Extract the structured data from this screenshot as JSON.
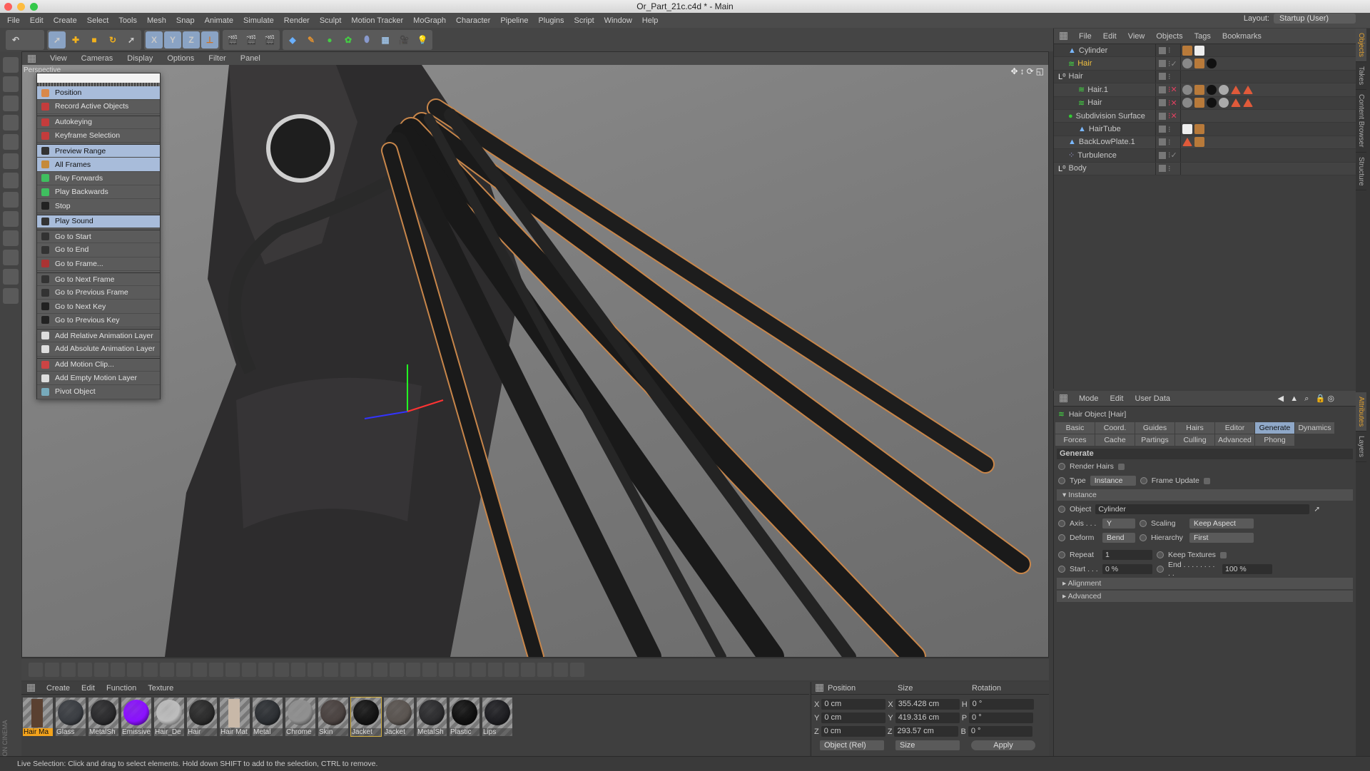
{
  "window": {
    "title": "Or_Part_21c.c4d * - Main"
  },
  "menubar": [
    "File",
    "Edit",
    "Create",
    "Select",
    "Tools",
    "Mesh",
    "Snap",
    "Animate",
    "Simulate",
    "Render",
    "Sculpt",
    "Motion Tracker",
    "MoGraph",
    "Character",
    "Pipeline",
    "Plugins",
    "Script",
    "Window",
    "Help"
  ],
  "layout": {
    "label": "Layout:",
    "value": "Startup (User)"
  },
  "toolbar": {
    "axis_x": "X",
    "axis_y": "Y",
    "axis_z": "Z"
  },
  "viewport": {
    "menu": [
      "View",
      "Cameras",
      "Display",
      "Options",
      "Filter",
      "Panel"
    ],
    "label": "Perspective"
  },
  "anim_menu": {
    "items": [
      {
        "label": "Position",
        "hl": true,
        "icon": "position-icon",
        "c": "#d9884a"
      },
      {
        "label": "Record Active Objects",
        "icon": "record-icon",
        "c": "#c43c3c"
      },
      {
        "label": "Autokeying",
        "sep": true,
        "icon": "autokey-icon",
        "c": "#c43c3c"
      },
      {
        "label": "Keyframe Selection",
        "icon": "keyframe-selection-icon",
        "c": "#c43c3c"
      },
      {
        "label": "Preview Range",
        "hl": true,
        "sep": true,
        "icon": "preview-range-icon",
        "c": "#333"
      },
      {
        "label": "All Frames",
        "hl": true,
        "icon": "film-icon",
        "c": "#c58a3a"
      },
      {
        "label": "Play Forwards",
        "icon": "play-forwards-icon",
        "c": "#3fbf5f"
      },
      {
        "label": "Play Backwards",
        "icon": "play-backwards-icon",
        "c": "#3fbf5f"
      },
      {
        "label": "Stop",
        "icon": "stop-icon",
        "c": "#222"
      },
      {
        "label": "Play Sound",
        "hl": true,
        "sep": true,
        "icon": "speaker-icon",
        "c": "#333"
      },
      {
        "label": "Go to Start",
        "sep": true,
        "icon": "go-to-start-icon",
        "c": "#333"
      },
      {
        "label": "Go to End",
        "icon": "go-to-end-icon",
        "c": "#333"
      },
      {
        "label": "Go to Frame...",
        "icon": "go-to-frame-icon",
        "c": "#a33"
      },
      {
        "label": "Go to Next Frame",
        "sep": true,
        "icon": "next-frame-icon",
        "c": "#333"
      },
      {
        "label": "Go to Previous Frame",
        "icon": "previous-frame-icon",
        "c": "#333"
      },
      {
        "label": "Go to Next Key",
        "icon": "next-key-icon",
        "c": "#222"
      },
      {
        "label": "Go to Previous Key",
        "icon": "previous-key-icon",
        "c": "#222"
      },
      {
        "label": "Add Relative Animation Layer",
        "sep": true,
        "icon": "relative-layer-icon",
        "c": "#ddd"
      },
      {
        "label": "Add Absolute Animation Layer",
        "icon": "absolute-layer-icon",
        "c": "#ddd"
      },
      {
        "label": "Add Motion Clip...",
        "sep": true,
        "icon": "motion-clip-icon",
        "c": "#c44"
      },
      {
        "label": "Add Empty Motion Layer",
        "icon": "motion-layer-icon",
        "c": "#ddd"
      },
      {
        "label": "Pivot Object",
        "icon": "pivot-icon",
        "c": "#7ab"
      }
    ]
  },
  "objects": {
    "menu": [
      "File",
      "Edit",
      "View",
      "Objects",
      "Tags",
      "Bookmarks"
    ],
    "rows": [
      {
        "name": "Cylinder",
        "indent": 1,
        "icon": "cylinder-icon",
        "tags": [
          "phong",
          "checker"
        ]
      },
      {
        "name": "Hair",
        "indent": 1,
        "icon": "hair-icon",
        "selected": true,
        "check": true,
        "tags": [
          "hair-material",
          "phong",
          "black-material"
        ]
      },
      {
        "name": "Hair",
        "indent": 0,
        "icon": "null-icon",
        "tags": []
      },
      {
        "name": "Hair.1",
        "indent": 2,
        "icon": "hair-icon",
        "x": true,
        "tags": [
          "hair-material",
          "phong",
          "black-material",
          "gray-material",
          "triangle",
          "triangle"
        ]
      },
      {
        "name": "Hair",
        "indent": 2,
        "icon": "hair-icon",
        "x": true,
        "tags": [
          "hair-material",
          "phong",
          "black-material",
          "gray-material",
          "triangle",
          "triangle"
        ]
      },
      {
        "name": "Subdivision Surface",
        "indent": 1,
        "icon": "subdivision-icon",
        "x": true,
        "tags": []
      },
      {
        "name": "HairTube",
        "indent": 2,
        "icon": "cylinder-icon",
        "tags": [
          "checker",
          "phong"
        ]
      },
      {
        "name": "BackLowPlate.1",
        "indent": 1,
        "icon": "cylinder-icon",
        "tags": [
          "triangle",
          "phong"
        ]
      },
      {
        "name": "Turbulence",
        "indent": 1,
        "icon": "turbulence-icon",
        "check": true,
        "tags": []
      },
      {
        "name": "Body",
        "indent": 0,
        "icon": "null-icon",
        "tags": []
      }
    ]
  },
  "right_tabs": [
    "Objects",
    "Takes",
    "Content Browser",
    "Structure"
  ],
  "right_tabs_lower": [
    "Attributes",
    "Layers"
  ],
  "attributes": {
    "menu": [
      "Mode",
      "Edit",
      "User Data"
    ],
    "object_title": "Hair Object [Hair]",
    "tabs": [
      "Basic",
      "Coord.",
      "Guides",
      "Hairs",
      "Editor",
      "Generate",
      "Dynamics",
      "Forces",
      "Cache",
      "Partings",
      "Culling",
      "Advanced",
      "Phong"
    ],
    "active_tab": "Generate",
    "section": "Generate",
    "render_hairs": "Render Hairs",
    "type_label": "Type",
    "type_value": "Instance",
    "frame_update": "Frame Update",
    "instance_section": "Instance",
    "object_label": "Object",
    "object_value": "Cylinder",
    "axis_label": "Axis . . .",
    "axis_value": "Y",
    "scaling_label": "Scaling",
    "scaling_value": "Keep Aspect",
    "deform_label": "Deform",
    "deform_value": "Bend",
    "hierarchy_label": "Hierarchy",
    "hierarchy_value": "First",
    "repeat_label": "Repeat",
    "repeat_value": "1",
    "keep_textures": "Keep Textures",
    "start_label": "Start . . .",
    "start_value": "0 %",
    "end_label": "End . . . . . . . . . .",
    "end_value": "100 %",
    "alignment": "Alignment",
    "advanced": "Advanced"
  },
  "materials": {
    "menu": [
      "Create",
      "Edit",
      "Function",
      "Texture"
    ],
    "items": [
      {
        "name": "Hair Ma",
        "color": "#5a4030",
        "sel": true,
        "flat": true
      },
      {
        "name": "Glass",
        "color": "#3a3d42"
      },
      {
        "name": "MetalSh",
        "color": "#2a2a2c"
      },
      {
        "name": "Emissive",
        "color": "#8a10ff"
      },
      {
        "name": "Hair_De",
        "color": "#bdbdbd"
      },
      {
        "name": "Hair",
        "color": "#2a2a2a"
      },
      {
        "name": "Hair Mat",
        "color": "#c8b8a8",
        "flat": true
      },
      {
        "name": "Metal",
        "color": "#2c2f33"
      },
      {
        "name": "Chrome",
        "color": "#909090"
      },
      {
        "name": "Skin",
        "color": "#4a4240"
      },
      {
        "name": "Jacket",
        "color": "#141414",
        "sel2": true
      },
      {
        "name": "Jacket",
        "color": "#5a5450"
      },
      {
        "name": "MetalSh",
        "color": "#2c2c2e"
      },
      {
        "name": "Plastic",
        "color": "#101010"
      },
      {
        "name": "Lips",
        "color": "#1e1e22"
      }
    ]
  },
  "coordinates": {
    "headers": [
      "Position",
      "Size",
      "Rotation"
    ],
    "rows": [
      {
        "p_axis": "X",
        "p": "0 cm",
        "s_axis": "X",
        "s": "355.428 cm",
        "r_axis": "H",
        "r": "0 °"
      },
      {
        "p_axis": "Y",
        "p": "0 cm",
        "s_axis": "Y",
        "s": "419.316 cm",
        "r_axis": "P",
        "r": "0 °"
      },
      {
        "p_axis": "Z",
        "p": "0 cm",
        "s_axis": "Z",
        "s": "293.57 cm",
        "r_axis": "B",
        "r": "0 °"
      }
    ],
    "mode": "Object (Rel)",
    "size_mode": "Size",
    "apply": "Apply"
  },
  "status": "Live Selection: Click and drag to select elements. Hold down SHIFT to add to the selection, CTRL to remove.",
  "brand": "MAXON CINEMA 4D",
  "colors": {
    "accent_selected": "#a8bcda",
    "object_selected_text": "#f0c040",
    "material_selected": "#f3a31c"
  }
}
